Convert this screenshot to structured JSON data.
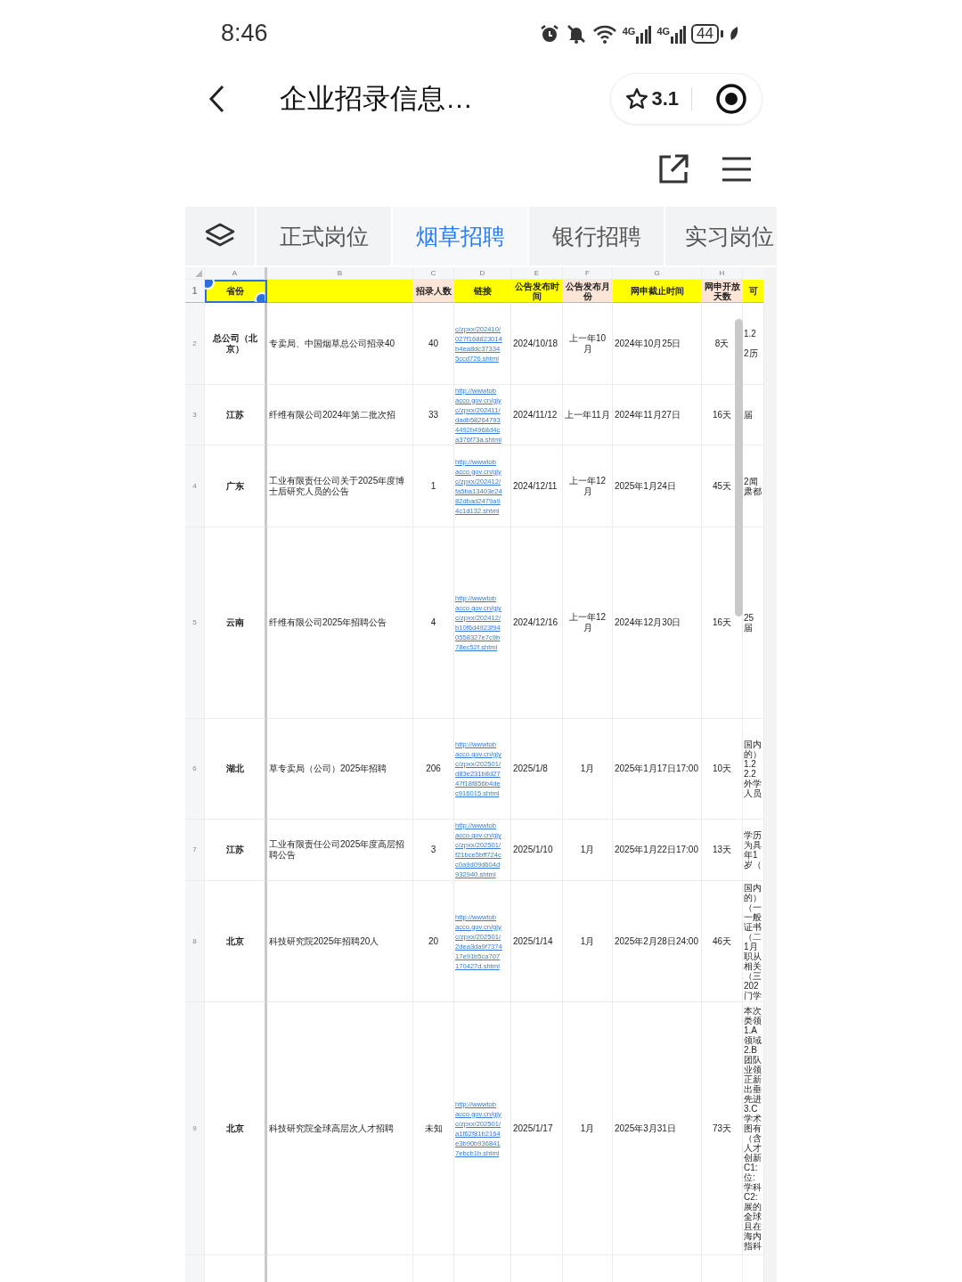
{
  "status_bar": {
    "time": "8:46",
    "network_labels": [
      "4G",
      "4G"
    ],
    "battery": "44"
  },
  "header": {
    "title": "企业招录信息…",
    "rating": "3.1"
  },
  "tabs": [
    {
      "label": "正式岗位",
      "selected": false
    },
    {
      "label": "烟草招聘",
      "selected": true
    },
    {
      "label": "银行招聘",
      "selected": false
    },
    {
      "label": "实习岗位",
      "selected": false
    }
  ],
  "sheet": {
    "column_letters": [
      "A",
      "B",
      "C",
      "D",
      "E",
      "F",
      "G",
      "H"
    ],
    "header_row": {
      "number": "1",
      "cells": [
        {
          "text": "省份",
          "color": "#ffff00",
          "selected": true
        },
        {
          "color": "#ffff00",
          "selected": false
        },
        {
          "text": "招录人数",
          "color": "#fce4d6",
          "selected": false
        },
        {
          "text": "链接",
          "color": "#ffff00",
          "selected": false
        },
        {
          "text": "公告发布时间",
          "color": "#ffff00",
          "selected": false
        },
        {
          "text": "公告发布月份",
          "color": "#fce4d6",
          "selected": false
        },
        {
          "text": "网申截止时间",
          "color": "#ffff00",
          "selected": false
        },
        {
          "text": "网申开放天数",
          "color": "#fce4d6",
          "selected": false
        },
        {
          "text": "可",
          "color": "#ffff00",
          "selected": false
        }
      ]
    },
    "rows": [
      {
        "number": "2",
        "province": "总公司（北京）",
        "title": "专卖局、中国烟草总公司招录40",
        "count": "40",
        "link": "c/zpxx/202410/\n027f168823014\nb4ea8dc37334\n5ccd726.shtml",
        "publish_date": "2024/10/18",
        "publish_month": "上一年10月",
        "deadline": "2024年10月25日",
        "open_days": "8天",
        "column_9": "1.2\n\n2历"
      },
      {
        "number": "3",
        "province": "江苏",
        "title": "纤维有限公司2024年第二批次招",
        "count": "33",
        "link": "http://wwwtob\nacco.gov.cn/gjy\nc/zpxx/202411/\ndadb58264793\n4492b4968d4c\na376f73a.shtml",
        "publish_date": "2024/11/12",
        "publish_month": "上一年11月",
        "deadline": "2024年11月27日",
        "open_days": "16天",
        "column_9": "届"
      },
      {
        "number": "4",
        "province": "广东",
        "title": "工业有限责任公司关于2025年度博士后研究人员的公告",
        "count": "1",
        "link": "http://wwwtob\nacco.gov.cn/gjy\nc/zpxx/202412/\nfa5ba13403e24\n82dbad2479a9\n4c1d132.shtml",
        "publish_date": "2024/12/11",
        "publish_month": "上一年12月",
        "deadline": "2025年1月24日",
        "open_days": "45天",
        "column_9": "2闻肃都"
      },
      {
        "number": "5",
        "province": "云南",
        "title": "纤维有限公司2025年招聘公告",
        "count": "4",
        "link": "http://wwwtob\nacco.gov.cn/gjy\nc/zpxx/202412/\nb10f6d4923f94\n0558327e7c9b\n78ec52f.shtml",
        "publish_date": "2024/12/16",
        "publish_month": "上一年12月",
        "deadline": "2024年12月30日",
        "open_days": "16天",
        "column_9": "25届"
      },
      {
        "number": "6",
        "province": "湖北",
        "title": "草专卖局（公司）2025年招聘",
        "count": "206",
        "link": "http://wwwtob\nacco.gov.cn/gjy\nc/zpxx/202501/\nd83e231b8d27\n47f18f856b4de\nc916015.shtml",
        "publish_date": "2025/1/8",
        "publish_month": "1月",
        "deadline": "2025年1月17日17:00",
        "open_days": "10天",
        "column_9": "国内的）1.2\n2.2外学人员"
      },
      {
        "number": "7",
        "province": "江苏",
        "title": "工业有限责任公司2025年度高层招聘公告",
        "count": "3",
        "link": "http://wwwtob\nacco.gov.cn/gjy\nc/zpxx/202501/\nf21bce5bff724c\nc0a9d09d604d\n932940.shtml",
        "publish_date": "2025/1/10",
        "publish_month": "1月",
        "deadline": "2025年1月22日17:00",
        "open_days": "13天",
        "column_9": "学历为具年1岁（"
      },
      {
        "number": "8",
        "province": "北京",
        "title": "科技研究院2025年招聘20人",
        "count": "20",
        "link": "http://wwwtob\nacco.gov.cn/gjy\nc/zpxx/202501/\n2dea3da9f7374\n17e91b5ca707\n170427d.shtml",
        "publish_date": "2025/1/14",
        "publish_month": "1月",
        "deadline": "2025年2月28日24:00",
        "open_days": "46天",
        "column_9": "国内的）（一一般证书（二1月职从相关（三202门学"
      },
      {
        "number": "9",
        "province": "北京",
        "title": "科技研究院全球高层次人才招聘",
        "count": "未知",
        "link": "http://wwwtob\nacco.gov.cn/gjy\nc/zpxx/202501/\na1f62f81b2164\ne3b90b936841\n7ebcb1b.shtml",
        "publish_date": "2025/1/17",
        "publish_month": "1月",
        "deadline": "2025年3月31日",
        "open_days": "73天",
        "column_9": "本次类领1.A领域2.B团队业领正新出垂先进3.C学术图有（含人才创新C1:位:学科C2:展的全球且在海内指科"
      }
    ]
  }
}
